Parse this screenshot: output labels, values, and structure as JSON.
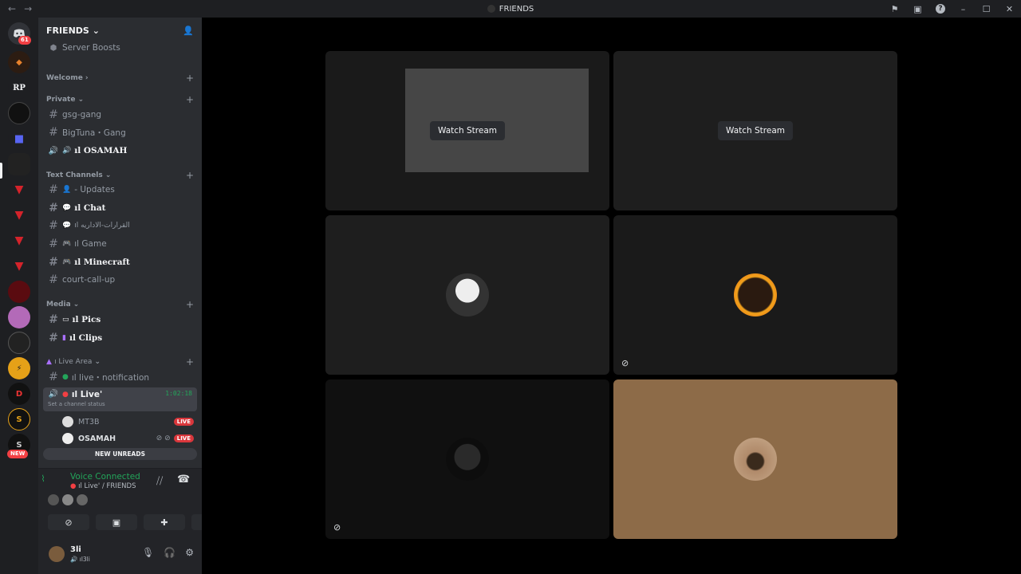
{
  "window": {
    "title": "FRIENDS",
    "back_icon": "←",
    "forward_icon": "→"
  },
  "rail": {
    "home_badge": "61",
    "rp_label": "RP",
    "new_badge": "NEW"
  },
  "sidebar": {
    "guild_name": "FRIENDS",
    "server_boosts": "Server Boosts",
    "categories": {
      "welcome": "Welcome",
      "private": "Private",
      "text": "Text Channels",
      "media": "Media",
      "live_area": "ı Live Area"
    },
    "channels": {
      "gsg": "gsg-gang",
      "bigtuna": "BigTuna・Gang",
      "osamah_voice": "ıl OSAMAH",
      "updates": "- Updates",
      "chat": "ıl Chat",
      "arabic": "ıl القرارات-الاداريه",
      "game": "ıl Game",
      "minecraft": "ıl Minecraft",
      "court": "court-call-up",
      "pics": "ıl Pics",
      "clips": "ıl Clips",
      "live_notif": "ıl live・notification",
      "live_voice": "ıl Live'"
    },
    "live_timer": "1:02:18",
    "channel_status_placeholder": "Set a channel status",
    "users": [
      {
        "name": "MT3B",
        "tag": "LIVE"
      },
      {
        "name": "OSAMAH",
        "tag": "LIVE"
      }
    ],
    "new_unreads": "NEW UNREADS"
  },
  "voice": {
    "status": "Voice Connected",
    "channel": "ıl Live' / FRIENDS"
  },
  "user": {
    "name": "3li",
    "subtext": "ıl3li"
  },
  "stage": {
    "watch_stream_label": "Watch Stream"
  }
}
